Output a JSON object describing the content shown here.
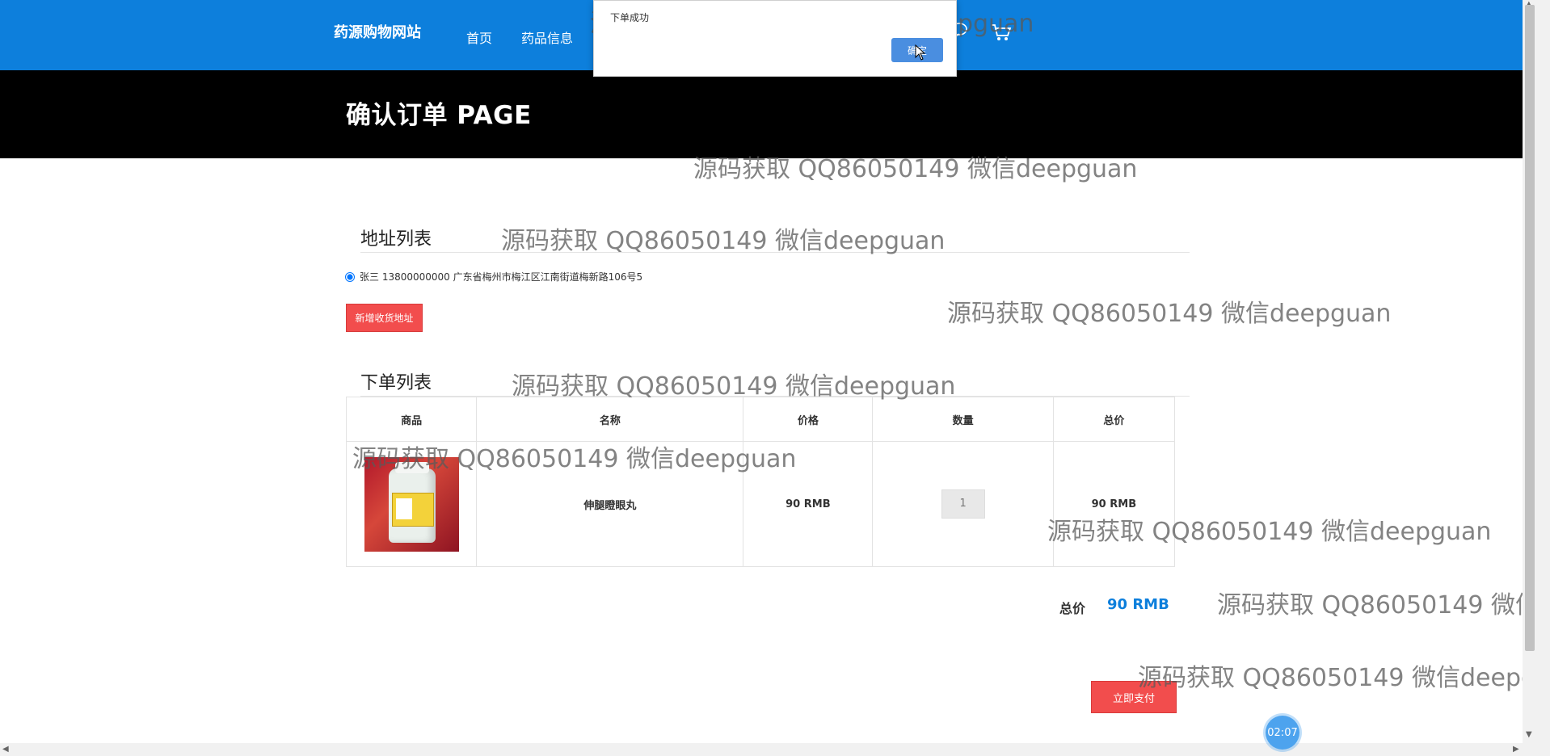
{
  "nav": {
    "brand": "药源购物网站",
    "links": [
      "首页",
      "药品信息"
    ],
    "right_icons": [
      "chat-icon",
      "cart-icon"
    ]
  },
  "hero": {
    "title": "确认订单 PAGE"
  },
  "address_section": {
    "title": "地址列表",
    "selected_address": "张三 13800000000 广东省梅州市梅江区江南街道梅新路106号5",
    "add_button": "新增收货地址"
  },
  "order_section": {
    "title": "下单列表",
    "columns": [
      "商品",
      "名称",
      "价格",
      "数量",
      "总价"
    ],
    "rows": [
      {
        "name": "伸腿瞪眼丸",
        "price": "90 RMB",
        "quantity": "1",
        "subtotal": "90 RMB"
      }
    ],
    "total_label": "总价",
    "total_value": "90 RMB",
    "pay_button": "立即支付"
  },
  "dialog": {
    "message": "下单成功",
    "ok_label": "确定"
  },
  "timer": "02:07",
  "watermark": "源码获取 QQ86050149 微信deepguan",
  "colors": {
    "primary": "#0d7fdc",
    "danger": "#f24d4d",
    "hero": "#000000"
  }
}
